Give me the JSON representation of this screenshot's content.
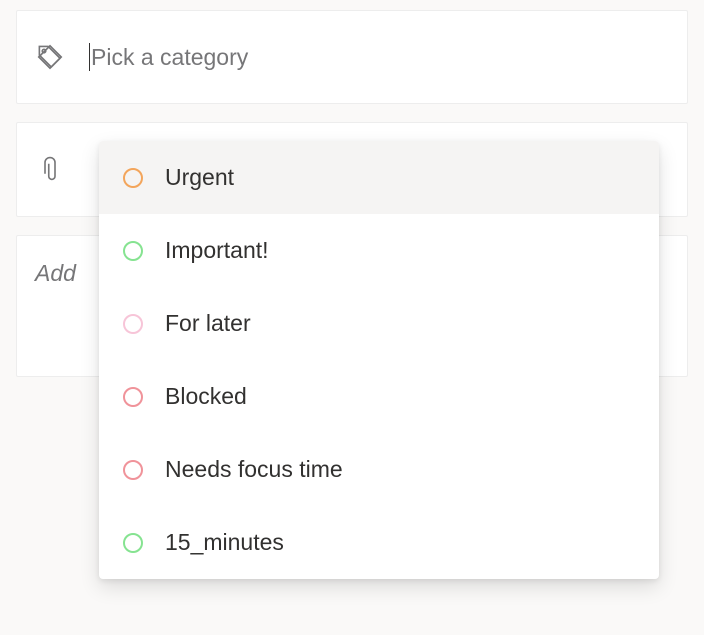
{
  "category_input": {
    "placeholder": "Pick a category",
    "value": ""
  },
  "file_input": {
    "placeholder": ""
  },
  "note": {
    "placeholder": "Add"
  },
  "dropdown": {
    "items": [
      {
        "label": "Urgent",
        "ring_color": "#f3a55b"
      },
      {
        "label": "Important!",
        "ring_color": "#86e391"
      },
      {
        "label": "For later",
        "ring_color": "#f7c5d8"
      },
      {
        "label": "Blocked",
        "ring_color": "#f0939a"
      },
      {
        "label": "Needs focus time",
        "ring_color": "#f0939a"
      },
      {
        "label": "15_minutes",
        "ring_color": "#86e391"
      }
    ],
    "highlighted_index": 0
  }
}
